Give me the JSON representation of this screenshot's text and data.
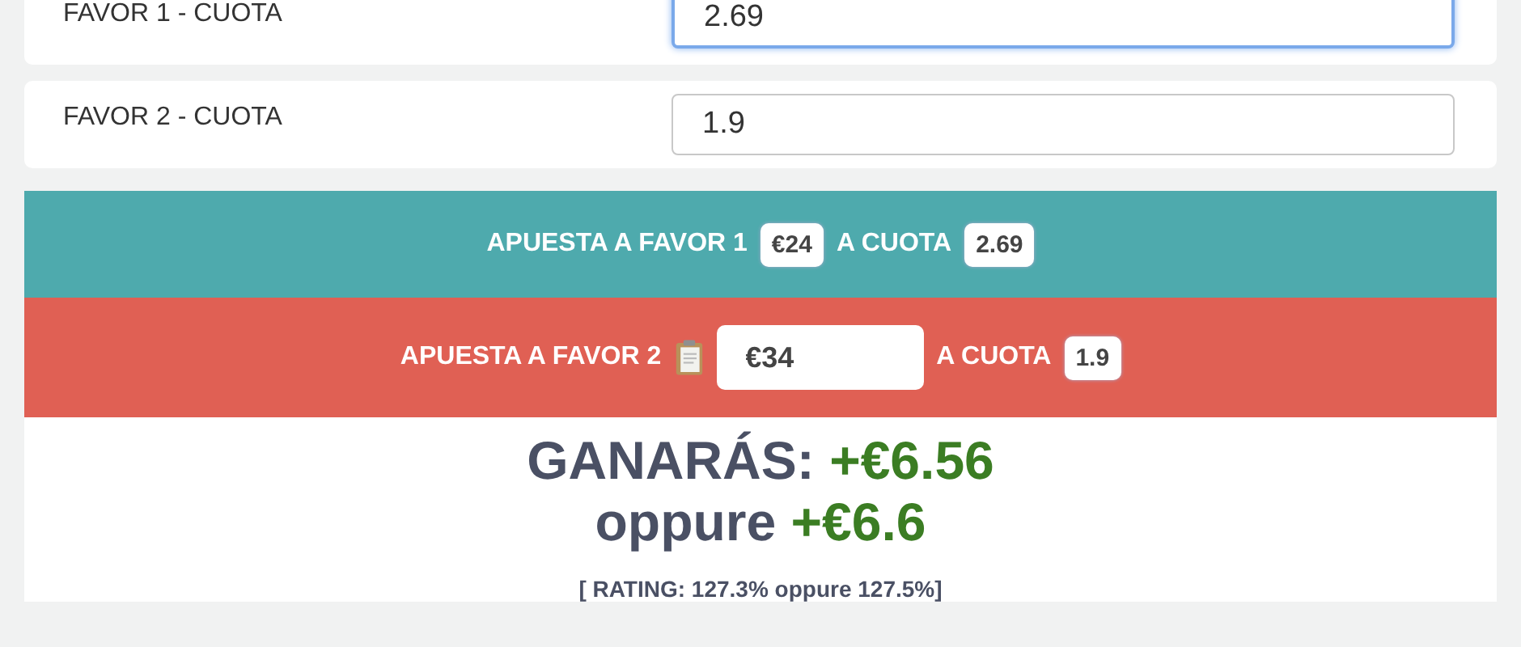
{
  "odds_fields": [
    {
      "label": "FAVOR 1 - CUOTA",
      "value": "2.69",
      "focused": true
    },
    {
      "label": "FAVOR 2 - CUOTA",
      "value": "1.9",
      "focused": false
    }
  ],
  "bets": [
    {
      "kind": "fixed",
      "color": "#4eaaad",
      "label": "APUESTA A FAVOR 1",
      "stake": "€24",
      "odds_label": "A CUOTA",
      "odds": "2.69"
    },
    {
      "kind": "editable",
      "color": "#e06054",
      "label": "APUESTA A FAVOR 2",
      "stake": "€34",
      "odds_label": "A CUOTA",
      "odds": "1.9"
    }
  ],
  "result": {
    "profit_label": "GANARÁS:",
    "profit": "+€6.56",
    "alt_label": "oppure",
    "alt_profit": "+€6.6",
    "rating": "[ RATING: 127.3% oppure 127.5%]"
  }
}
